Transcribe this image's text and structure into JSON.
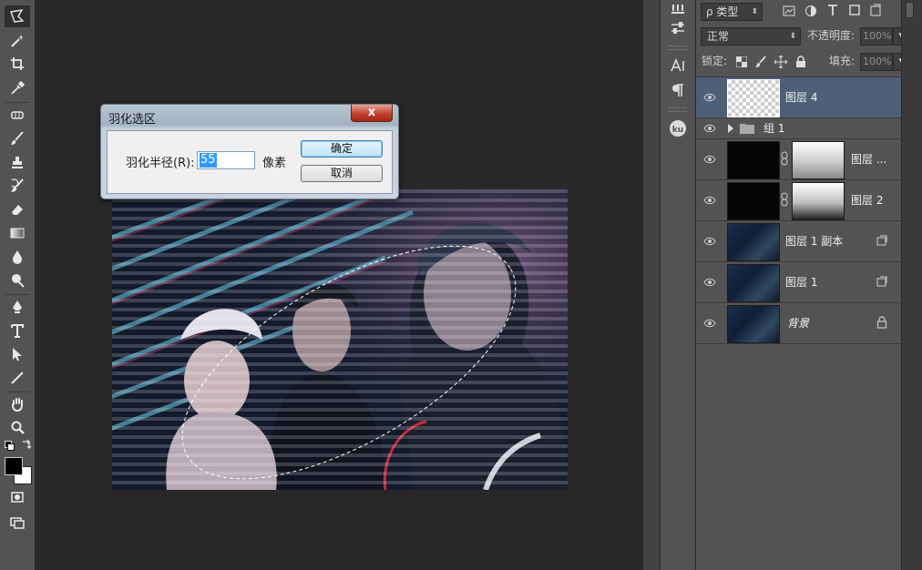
{
  "dialog": {
    "title": "羽化选区",
    "close_label": "x",
    "radius_label": "羽化半径(R):",
    "radius_value": "55",
    "unit_label": "像素",
    "ok_label": "确定",
    "cancel_label": "取消"
  },
  "layers_panel": {
    "filter_label": "ρ 类型",
    "blend_mode": "正常",
    "opacity_label": "不透明度:",
    "opacity_value": "100%",
    "lock_label": "锁定:",
    "fill_label": "填充:",
    "fill_value": "100%",
    "layers": [
      {
        "name": "图层 4",
        "thumb": "transparent",
        "selected": true
      },
      {
        "name": "组 1",
        "type": "group"
      },
      {
        "name": "图层 ...",
        "thumb": "black",
        "mask": "gradient-light"
      },
      {
        "name": "图层 2",
        "thumb": "black",
        "mask": "gradient"
      },
      {
        "name": "图层 1 副本",
        "thumb": "photo",
        "badge": "smart-object"
      },
      {
        "name": "图层 1",
        "thumb": "photo",
        "badge": "smart-object"
      },
      {
        "name": "背景",
        "thumb": "photo",
        "badge": "lock"
      }
    ]
  },
  "panel_icons": [
    "character-icon",
    "paragraph-icon",
    "kuler-icon"
  ],
  "colors": {
    "workspace": "#282828",
    "panel": "#535353",
    "selected_layer": "#4f5f78",
    "dialog_ok": "#bde4f8",
    "close_button": "#c3422e"
  }
}
